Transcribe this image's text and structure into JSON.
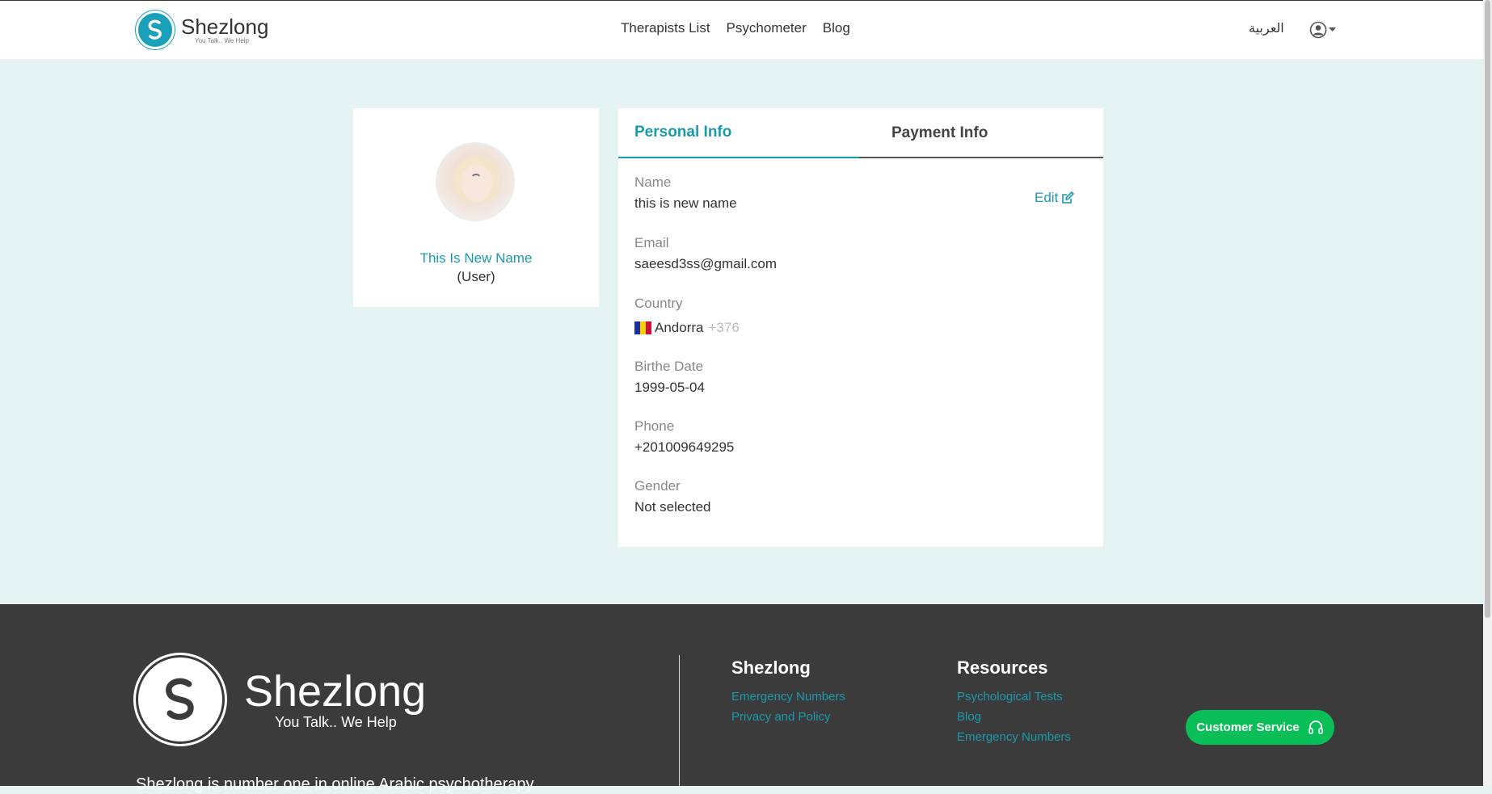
{
  "header": {
    "brand": "Shezlong",
    "tagline": "You Talk.. We Help",
    "nav": [
      "Therapists List",
      "Psychometer",
      "Blog"
    ],
    "language_link": "العربية"
  },
  "profile": {
    "display_name": "This Is New Name",
    "role": "(User)"
  },
  "tabs": {
    "personal": "Personal Info",
    "payment": "Payment Info"
  },
  "personal_info": {
    "edit_label": "Edit",
    "name_label": "Name",
    "name_value": "this is new name",
    "email_label": "Email",
    "email_value": "saeesd3ss@gmail.com",
    "country_label": "Country",
    "country_value": "Andorra",
    "country_code": "+376",
    "birth_label": "Birthe Date",
    "birth_value": "1999-05-04",
    "phone_label": "Phone",
    "phone_value": "+201009649295",
    "gender_label": "Gender",
    "gender_value": "Not selected"
  },
  "footer": {
    "brand": "Shezlong",
    "tagline": "You Talk.. We Help",
    "description": "Shezlong is number one in online Arabic psychotherapy",
    "col1_title": "Shezlong",
    "col1_links": [
      "Emergency Numbers",
      "Privacy and Policy"
    ],
    "col2_title": "Resources",
    "col2_links": [
      "Psychological Tests",
      "Blog",
      "Emergency Numbers"
    ],
    "customer_service": "Customer Service"
  },
  "colors": {
    "accent": "#1a9aad",
    "page_bg": "#e5f3f3",
    "footer_bg": "#3b3b3b",
    "cs_button": "#0bbf58"
  }
}
